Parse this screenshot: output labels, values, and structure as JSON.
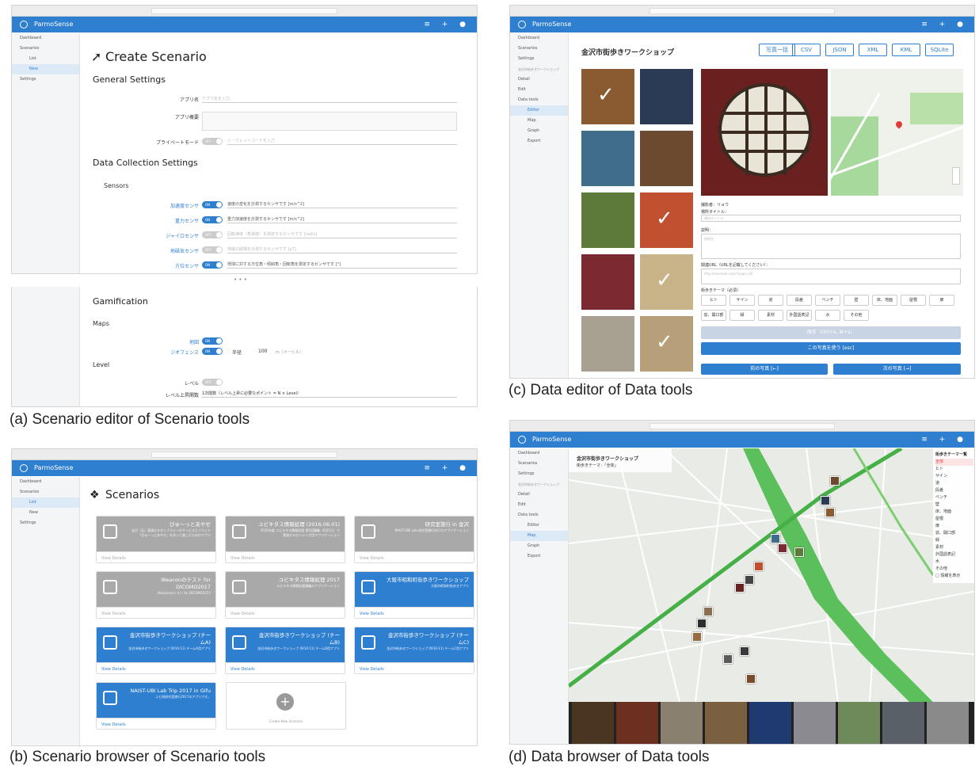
{
  "app": {
    "name": "ParmoSense"
  },
  "sidebar": {
    "dashboard": "Dashboard",
    "scenarios": "Scenarios",
    "list": "List",
    "new": "New",
    "settings": "Settings",
    "workshop": "金沢市街歩きワークショップ",
    "detail": "Detail",
    "edit": "Edit",
    "datatools": "Data tools",
    "editor": "Editor",
    "map": "Map",
    "graph": "Graph",
    "export": "Export"
  },
  "captions": {
    "a": "(a) Scenario editor of Scenario tools",
    "b": "(b) Scenario browser of Scenario tools",
    "c": "(c) Data editor of Data tools",
    "d": "(d) Data browser of Data tools"
  },
  "panelA": {
    "title": "Create Scenario",
    "general": "General Settings",
    "appname_label": "アプリ名",
    "appname_ph": "アプリ名を入力",
    "appdesc_label": "アプリ概要",
    "private_label": "プライベートモード",
    "private_toggle": "OFF",
    "secret_ph": "シークレットコードを入力",
    "datacoll": "Data Collection Settings",
    "sensors": "Sensors",
    "sensor_rows": [
      {
        "label": "加速度センサ",
        "state": "ON",
        "desc": "速度の変化を計測するセンサです [m/s^2]",
        "on": true
      },
      {
        "label": "重力センサ",
        "state": "ON",
        "desc": "重力加速度を計測するセンサです [m/s^2]",
        "on": true
      },
      {
        "label": "ジャイロセンサ",
        "state": "OFF",
        "desc": "回転速度（角速度）を測定するセンサです [rad/s]",
        "on": false
      },
      {
        "label": "地磁気センサ",
        "state": "OFF",
        "desc": "地磁の磁場を計測するセンサです [μT]",
        "on": false
      },
      {
        "label": "方位センサ",
        "state": "ON",
        "desc": "地球に対する方位角・傾斜角・回転角を測定するセンサです [°]",
        "on": true
      }
    ],
    "ellipsis": "• • •",
    "gamification": "Gamification",
    "maps": "Maps",
    "map_label": "地図",
    "map_state": "ON",
    "geofence_label": "ジオフェンス",
    "geofence_state": "ON",
    "radius_label": "半径",
    "radius_value": "100",
    "radius_unit": "m（メートル）",
    "level": "Level",
    "level_label": "レベル",
    "level_state": "OFF",
    "levelup_label": "レベル上昇関数",
    "levelup_value": "1次関数（レベル上昇に必要なポイント = N × Level）"
  },
  "panelB": {
    "title": "Scenarios",
    "view": "View Details",
    "cards": [
      {
        "title": "ぴゅ〜っとあやせ",
        "desc": "金沢（石）湯涌のスタンプラリーのサービスとイベント「ぴゅ〜っとあやせ」を作って楽しむためのアプリ",
        "style": "gray"
      },
      {
        "title": "ユビキタス情報処理 (2016.06.01)",
        "desc": "2016年度 ユビキタス情報処理 第6回講義（6月1日）で実施するセンシング用アプリケーション",
        "style": "gray"
      },
      {
        "title": "研究室旅行 in 金沢",
        "desc": "NAIST-UBI Lab 研究室旅行向けのアプリケーション",
        "style": "gray"
      },
      {
        "title": "iBeaconのテスト for DICOMO2017",
        "desc": "iBeaconのテスト for DICOMO2017",
        "style": "gray"
      },
      {
        "title": "ユビキタス情報処理 2017",
        "desc": "ユビキタス情報処理講義のアプリケーション",
        "style": "gray"
      },
      {
        "title": "大阪市昭和町街歩きワークショップ",
        "desc": "大阪市昭和町街歩きアプリ",
        "style": "blue"
      },
      {
        "title": "金沢市街歩きワークショップ (チームA)",
        "desc": "金沢市街歩きワークショップ (9/10-11) チームA用アプリ",
        "style": "blue"
      },
      {
        "title": "金沢市街歩きワークショップ (チームB)",
        "desc": "金沢市街歩きワークショップ (9/10-11) チームB用アプリ",
        "style": "blue"
      },
      {
        "title": "金沢市街歩きワークショップ (チームC)",
        "desc": "金沢市街歩きワークショップ (9/10-11) チームC用アプリ",
        "style": "blue"
      },
      {
        "title": "NAIST-UBI Lab Trip 2017 in Gifu",
        "desc": "ユビ研研究室旅行2017のアプリです。",
        "style": "blue"
      }
    ],
    "create": "Create New Scenario"
  },
  "panelC": {
    "title": "金沢市街歩きワークショップ",
    "exports": [
      "写真一括",
      "CSV",
      "JSON",
      "XML",
      "KML",
      "SQLite"
    ],
    "photographer": "撮影者：リョウ",
    "place_title_label": "場所タイトル：",
    "place_title_ph": "場所タイトル",
    "desc_label": "説明：",
    "desc_ph": "説明文",
    "url_label": "関連URL（URLを記載してください）：",
    "url_ph": "http://example.com/?page=26",
    "theme_label": "街歩きテーマ（必須）",
    "tags": [
      "ヒト",
      "サイン",
      "道",
      "段差",
      "ベンチ",
      "壁",
      "床、地面",
      "屋根",
      "扉",
      "窓、開口部",
      "緑",
      "素材",
      "外国語表記",
      "水",
      "その他"
    ],
    "save": "保存（Ctrl+s, ⌘+s）",
    "use_photo": "この写真を使う [esc]",
    "prev": "前の写真 [←]",
    "next": "次の写真 [→]"
  },
  "panelD": {
    "title": "金沢市街歩きワークショップ",
    "subtitle": "街歩きテーマ：「全体」",
    "legend_title": "街歩きテーマ一覧",
    "legend": [
      "全体",
      "ヒト",
      "サイン",
      "道",
      "段差",
      "ベンチ",
      "壁",
      "床、地面",
      "屋根",
      "扉",
      "窓、開口部",
      "緑",
      "素材",
      "外国語表記",
      "水",
      "その他",
      "□ 情報を表示"
    ]
  }
}
